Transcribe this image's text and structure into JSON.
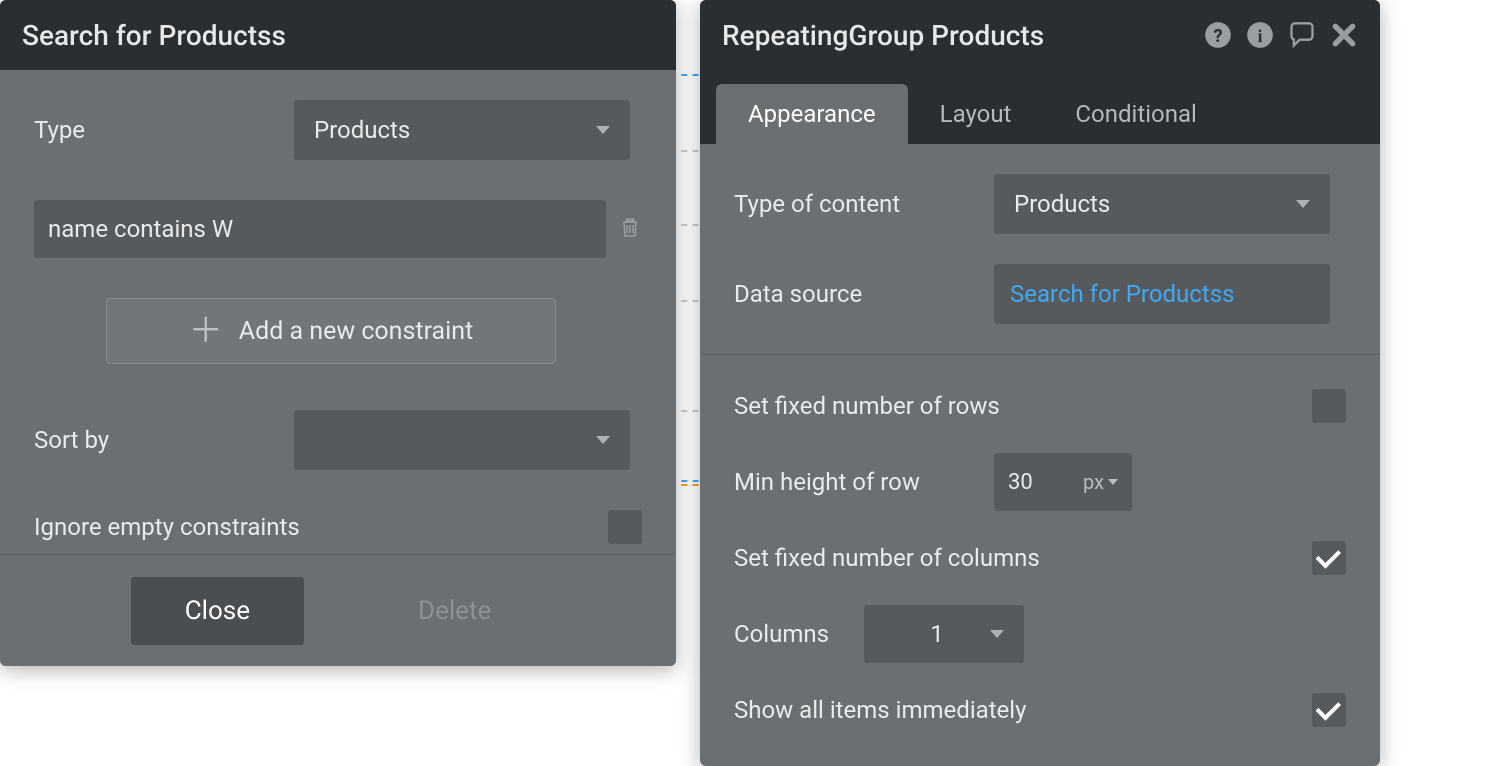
{
  "leftPanel": {
    "title": "Search for Productss",
    "typeLabel": "Type",
    "typeValue": "Products",
    "constraint": "name contains  W",
    "addConstraintLabel": "Add a new constraint",
    "sortByLabel": "Sort by",
    "sortByValue": "",
    "ignoreEmptyLabel": "Ignore empty constraints",
    "closeLabel": "Close",
    "deleteLabel": "Delete"
  },
  "rightPanel": {
    "title": "RepeatingGroup Products",
    "tabs": {
      "appearance": "Appearance",
      "layout": "Layout",
      "conditional": "Conditional"
    },
    "typeOfContentLabel": "Type of content",
    "typeOfContentValue": "Products",
    "dataSourceLabel": "Data source",
    "dataSourceValue": "Search for Productss",
    "fixedRowsLabel": "Set fixed number of rows",
    "minHeightLabel": "Min height of row",
    "minHeightValue": "30",
    "minHeightUnit": "px",
    "fixedColsLabel": "Set fixed number of columns",
    "columnsLabel": "Columns",
    "columnsValue": "1",
    "showAllLabel": "Show all items immediately"
  }
}
